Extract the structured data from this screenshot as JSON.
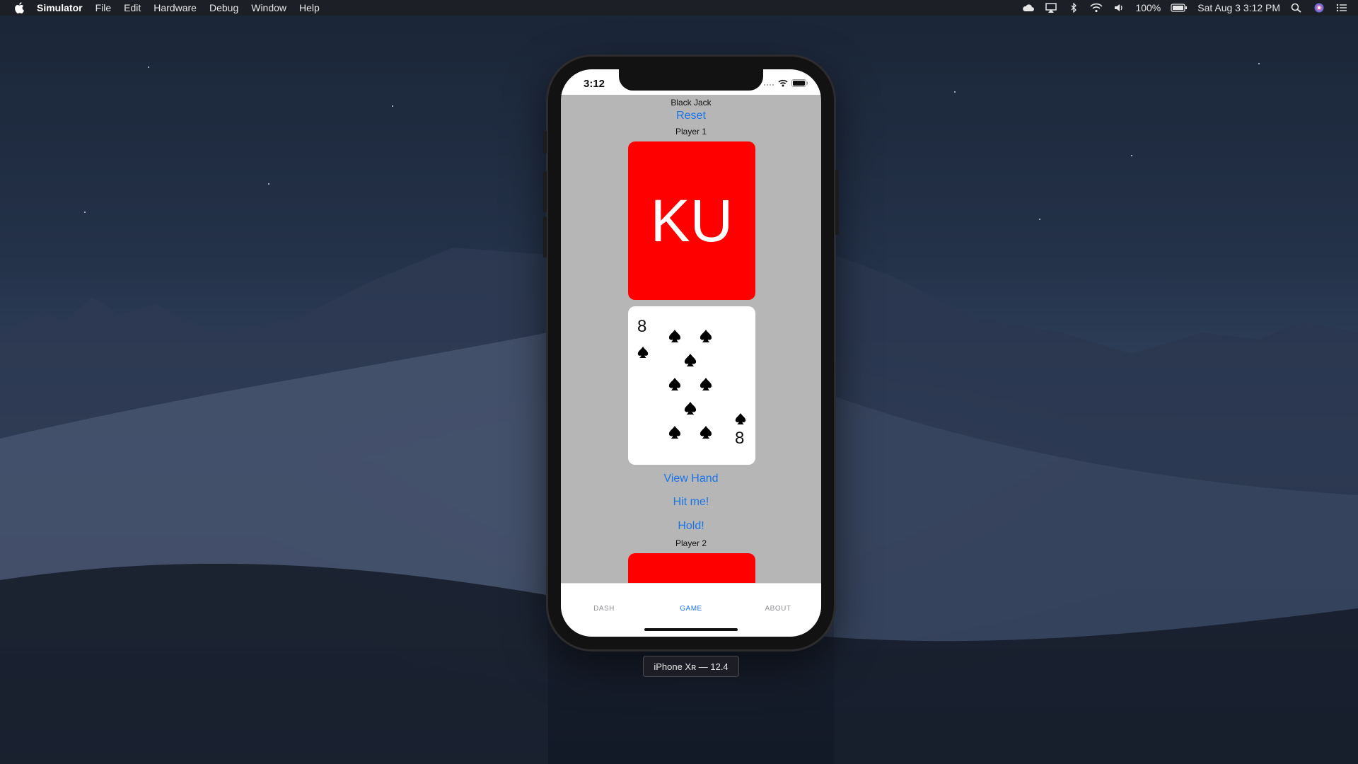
{
  "menubar": {
    "app_name": "Simulator",
    "items": [
      "File",
      "Edit",
      "Hardware",
      "Debug",
      "Window",
      "Help"
    ],
    "battery": "100%",
    "datetime": "Sat Aug 3  3:12 PM",
    "icons": [
      "apple-icon",
      "cloud-icon",
      "airplay-icon",
      "bluetooth-icon",
      "wifi-icon",
      "volume-icon",
      "battery-icon",
      "spotlight-icon",
      "siri-icon",
      "notification-center-icon"
    ]
  },
  "phone": {
    "status": {
      "time": "3:12"
    },
    "app": {
      "title": "Black Jack",
      "reset_label": "Reset",
      "player1_label": "Player 1",
      "card_back_text": "KU",
      "face_card": {
        "rank": "8",
        "suit": "spades",
        "suit_symbol": "♠"
      },
      "view_hand_label": "View Hand",
      "hit_label": "Hit me!",
      "hold_label": "Hold!",
      "player2_label": "Player 2"
    },
    "tabs": [
      {
        "label": "DASH",
        "active": false
      },
      {
        "label": "GAME",
        "active": true
      },
      {
        "label": "ABOUT",
        "active": false
      }
    ]
  },
  "device_caption": "iPhone Xʀ — 12.4",
  "colors": {
    "link_blue": "#1a74e8",
    "card_red": "#ff0000",
    "app_background": "#b6b6b6"
  }
}
